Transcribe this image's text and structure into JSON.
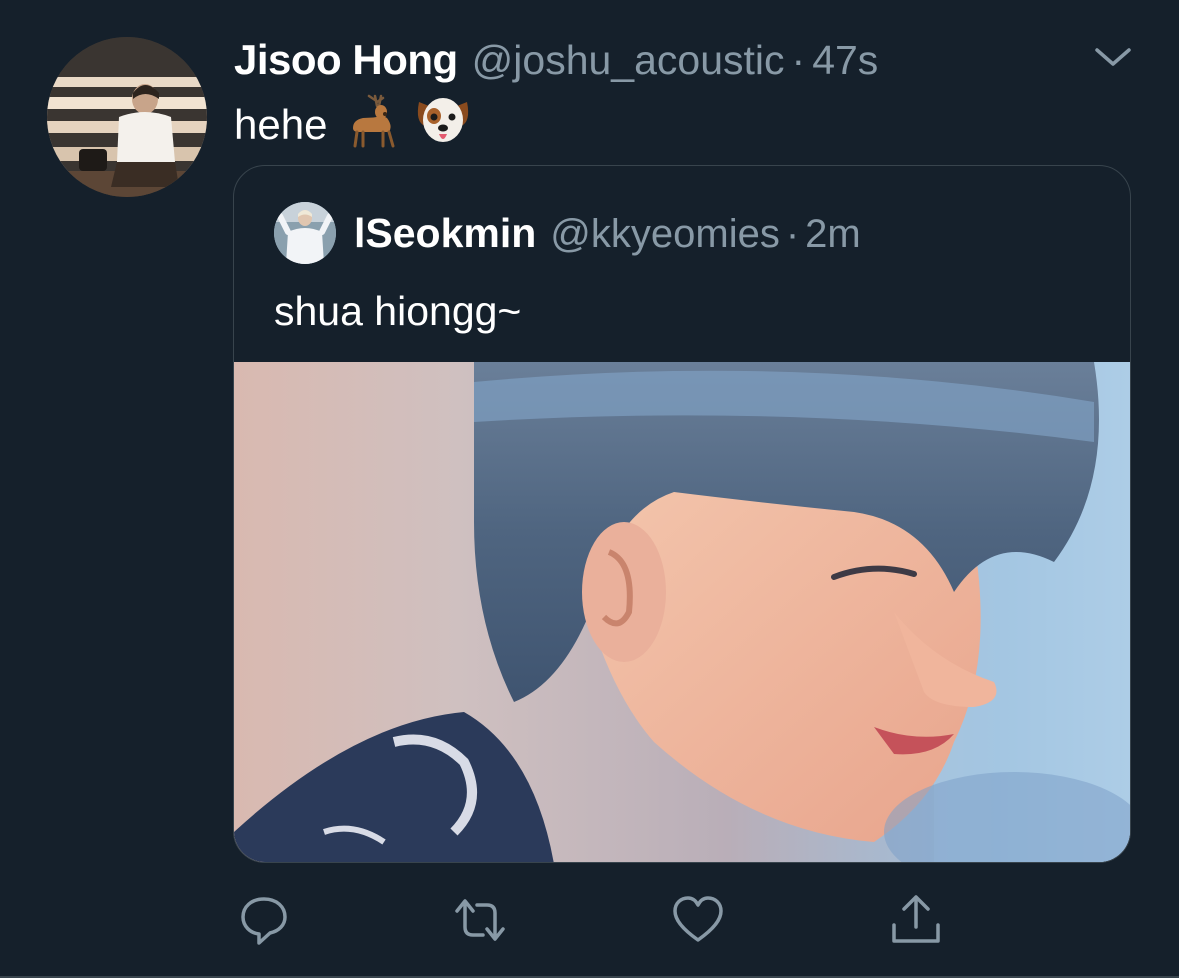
{
  "tweet": {
    "author_name": "Jisoo Hong",
    "author_handle": "@joshu_acoustic",
    "separator": "·",
    "time": "47s",
    "text": "hehe",
    "emojis": [
      "🦌",
      "🐶"
    ]
  },
  "quoted": {
    "author_name": "lSeokmin",
    "author_handle": "@kkyeomies",
    "separator": "·",
    "time": "2m",
    "text": "shua hiongg~"
  },
  "icons": {
    "menu": "chevron-down-icon",
    "reply": "reply-icon",
    "retweet": "retweet-icon",
    "like": "heart-icon",
    "share": "share-icon"
  },
  "colors": {
    "background": "#15202b",
    "text": "#ffffff",
    "muted": "#8899a6",
    "border": "#38444d"
  }
}
